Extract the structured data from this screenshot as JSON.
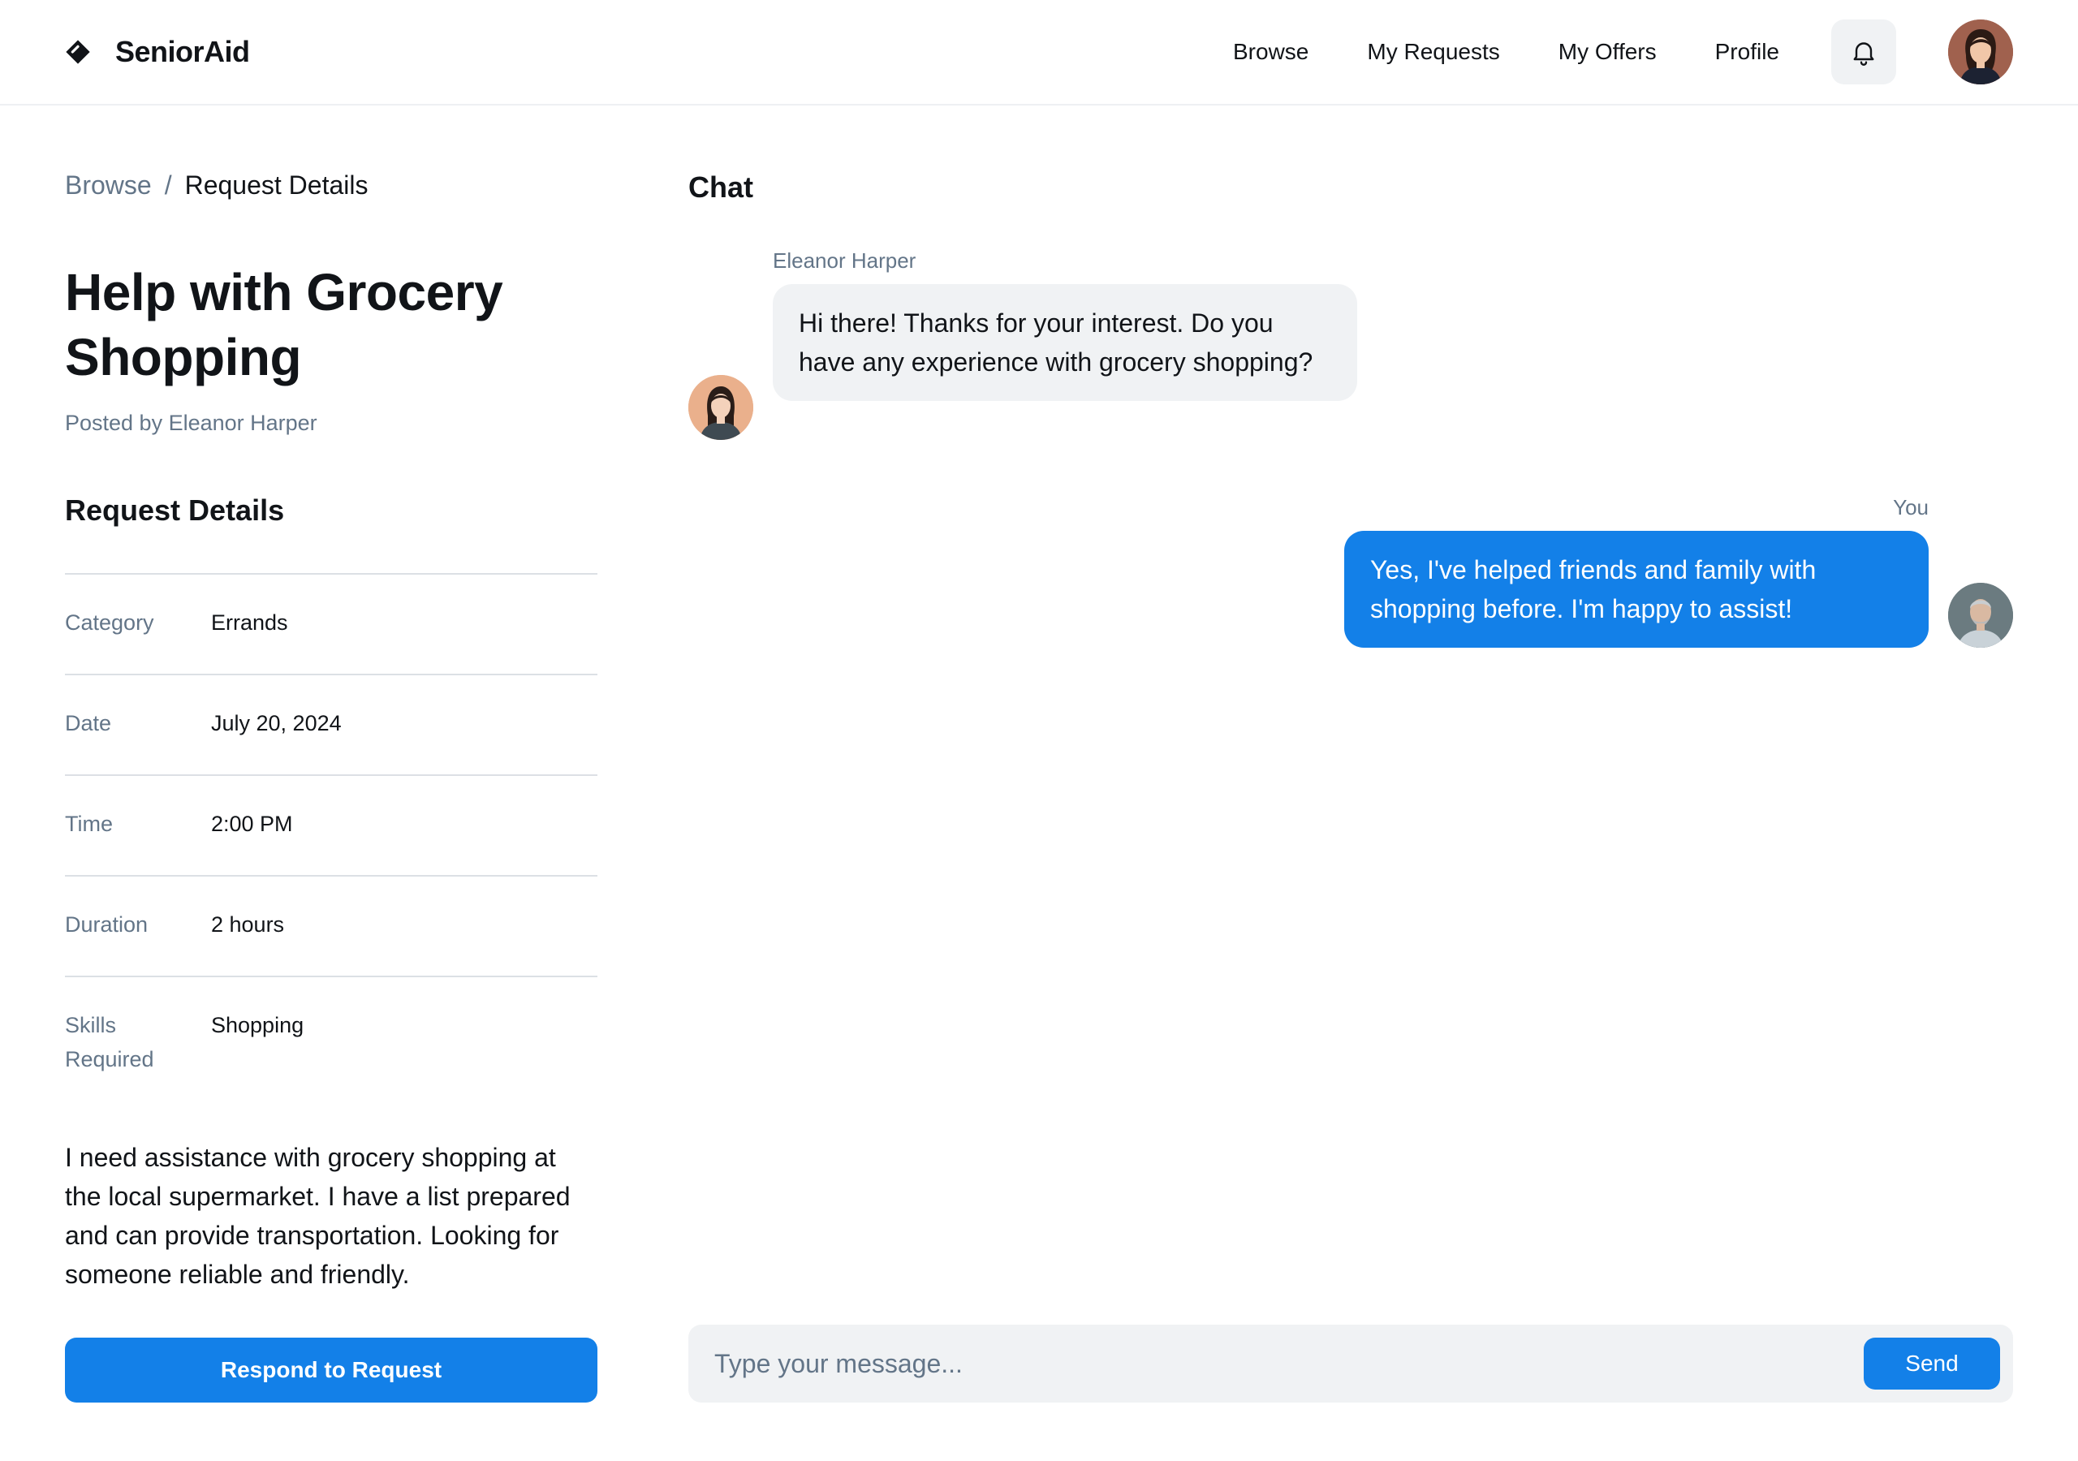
{
  "app": {
    "name": "SeniorAid"
  },
  "nav": {
    "items": [
      {
        "label": "Browse"
      },
      {
        "label": "My Requests"
      },
      {
        "label": "My Offers"
      },
      {
        "label": "Profile"
      }
    ]
  },
  "breadcrumb": {
    "parent": "Browse",
    "separator": "/",
    "current": "Request Details"
  },
  "request": {
    "title": "Help with Grocery Shopping",
    "posted_by": "Posted by Eleanor Harper",
    "section_title": "Request Details",
    "details": [
      {
        "label": "Category",
        "value": "Errands"
      },
      {
        "label": "Date",
        "value": "July 20, 2024"
      },
      {
        "label": "Time",
        "value": "2:00 PM"
      },
      {
        "label": "Duration",
        "value": "2 hours"
      },
      {
        "label": "Skills Required",
        "value": "Shopping"
      }
    ],
    "description": "I need assistance with grocery shopping at the local supermarket. I have a list prepared and can provide transportation. Looking for someone reliable and friendly.",
    "respond_label": "Respond to Request"
  },
  "chat": {
    "title": "Chat",
    "messages": [
      {
        "sender": "Eleanor Harper",
        "text": "Hi there! Thanks for your interest. Do you have any experience with grocery shopping?"
      },
      {
        "sender": "You",
        "text": "Yes, I've helped friends and family with shopping before. I'm happy to assist!"
      }
    ],
    "input_placeholder": "Type your message...",
    "send_label": "Send"
  },
  "colors": {
    "accent": "#1380e8",
    "muted": "#637588",
    "bubble_bg": "#f0f2f4"
  },
  "icons": {
    "logo": "tag-icon",
    "notifications": "bell-icon"
  }
}
